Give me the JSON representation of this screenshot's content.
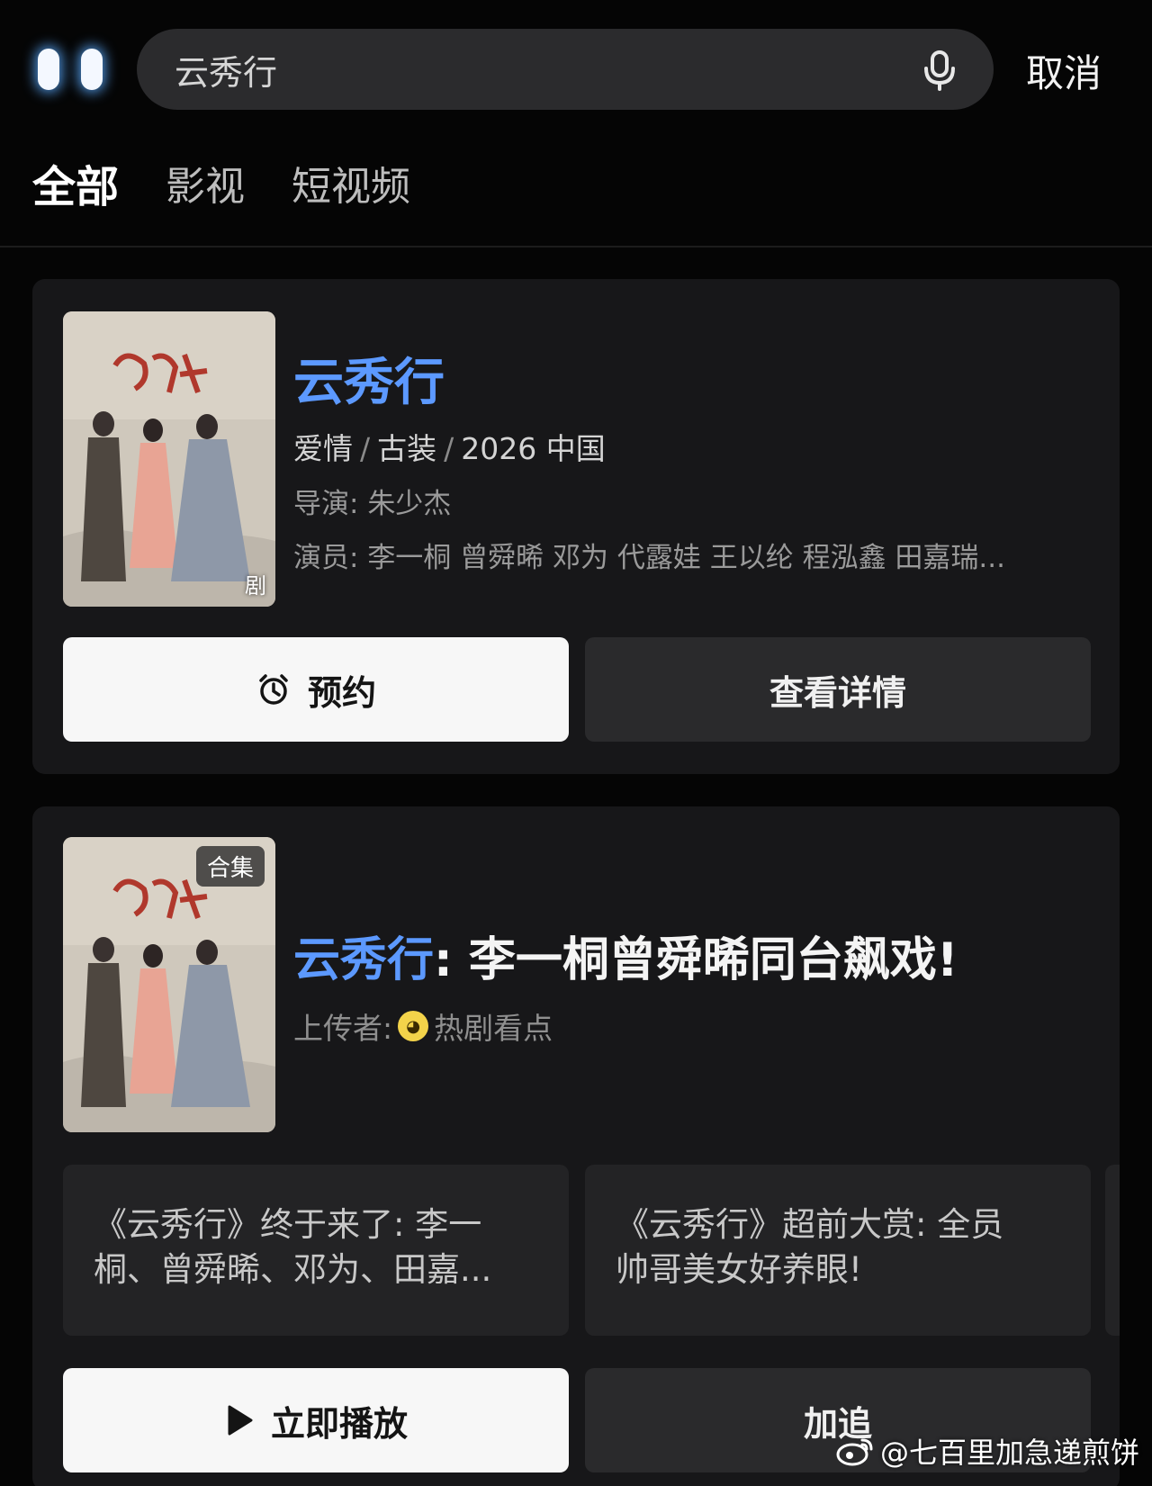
{
  "search": {
    "query": "云秀行",
    "cancel_label": "取消"
  },
  "tabs": [
    {
      "label": "全部",
      "active": true
    },
    {
      "label": "影视",
      "active": false
    },
    {
      "label": "短视频",
      "active": false
    }
  ],
  "series_card": {
    "title": "云秀行",
    "poster_tag": "剧",
    "genres": [
      "爱情",
      "古装"
    ],
    "year_region": "2026 中国",
    "director_label": "导演:",
    "director": "朱少杰",
    "cast_label": "演员:",
    "cast": "李一桐 曾舜晞 邓为 代露娃 王以纶 程泓鑫 田嘉瑞...",
    "reserve_label": "预约",
    "details_label": "查看详情"
  },
  "video_card": {
    "badge": "合集",
    "title_highlight": "云秀行",
    "title_rest": ": 李一桐曾舜晞同台飙戏!",
    "uploader_label": "上传者:",
    "uploader_name": "热剧看点",
    "clips": [
      {
        "line1": "《云秀行》终于来了: 李一",
        "line2": "桐、曾舜晞、邓为、田嘉..."
      },
      {
        "line1": "《云秀行》超前大赏: 全员",
        "line2": "帅哥美女好养眼!"
      }
    ],
    "play_label": "立即播放",
    "follow_label": "加追"
  },
  "watermark": {
    "text": "@七百里加急递煎饼",
    "icon": "weibo-icon"
  },
  "colors": {
    "accent": "#5c99ff",
    "background": "#050505",
    "card": "#171719"
  }
}
